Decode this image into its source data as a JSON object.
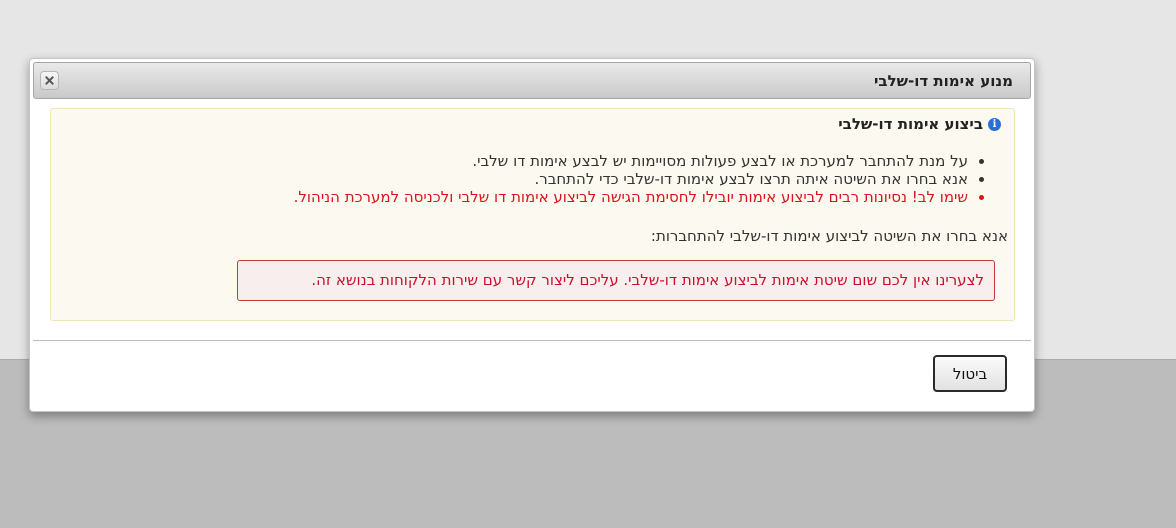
{
  "dialog": {
    "title": "מנוע אימות דו-שלבי",
    "close_icon": "close-icon"
  },
  "info": {
    "icon": "info-icon",
    "icon_glyph": "i",
    "heading": "ביצוע אימות דו-שלבי",
    "bullets": [
      "על מנת להתחבר למערכת או לבצע פעולות מסויימות יש לבצע אימות דו שלבי.",
      "אנא בחרו את השיטה איתה תרצו לבצע אימות דו-שלבי כדי להתחבר.",
      "שימו לב! נסיונות רבים לביצוע אימות יובילו לחסימת הגישה לביצוע אימות דו שלבי ולכניסה למערכת הניהול."
    ],
    "choose_method": "אנא בחרו את השיטה לביצוע אימות דו-שלבי להתחברות:",
    "error_message": "לצערינו אין לכם שום שיטת אימות לביצוע אימות דו-שלבי. עליכם ליצור קשר עם שירות הלקוחות בנושא זה."
  },
  "footer": {
    "cancel_label": "ביטול"
  },
  "colors": {
    "warning_text": "#d9141b",
    "error_border": "#c43a3a",
    "info_bg": "#fcfaf0",
    "info_icon": "#2b6fd6"
  }
}
